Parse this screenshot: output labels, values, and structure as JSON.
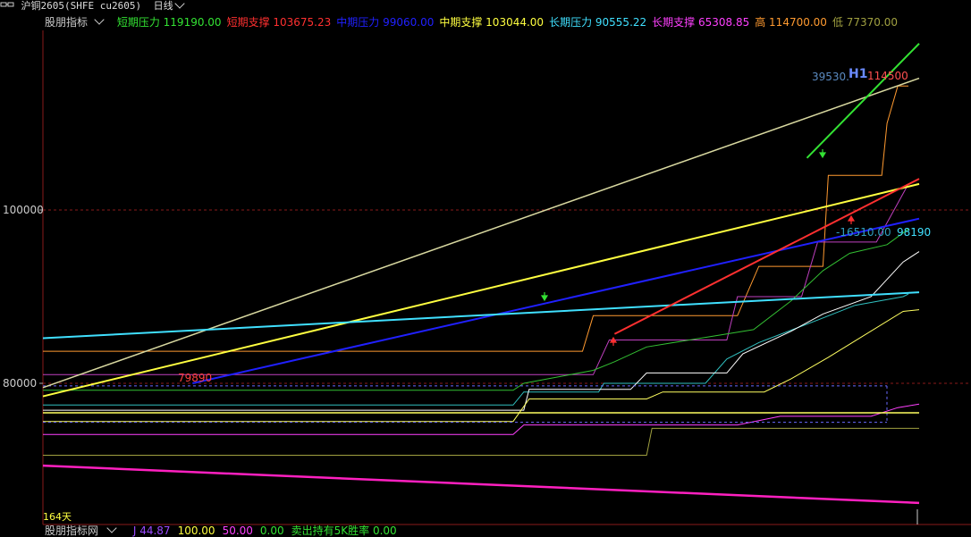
{
  "header": {
    "symbol": "沪铜2605(SHFE cu2605)",
    "period": "日线"
  },
  "legend": {
    "name": "股朋指标",
    "items": [
      {
        "label": "短期压力",
        "value": "119190.00",
        "color": "#33e233"
      },
      {
        "label": "短期支撑",
        "value": "103675.23",
        "color": "#ff3030"
      },
      {
        "label": "中期压力",
        "value": "99060.00",
        "color": "#2020ff"
      },
      {
        "label": "中期支撑",
        "value": "103044.00",
        "color": "#ffff40"
      },
      {
        "label": "长期压力",
        "value": "90555.22",
        "color": "#40e0ff"
      },
      {
        "label": "长期支撑",
        "value": "65308.85",
        "color": "#ff40ff"
      },
      {
        "label": "高",
        "value": "114700.00",
        "color": "#ff9a30"
      },
      {
        "label": "低",
        "value": "77370.00",
        "color": "#a0a040"
      }
    ]
  },
  "subwindow": {
    "name": "股朋指标网",
    "items": [
      {
        "label": "J",
        "value": "44.87",
        "color": "#9a4aff"
      },
      {
        "label": "",
        "value": "100.00",
        "color": "#ffff40"
      },
      {
        "label": "",
        "value": "50.00",
        "color": "#ff40ff"
      },
      {
        "label": "",
        "value": "0.00",
        "color": "#33e233"
      },
      {
        "label": "卖出持有5K胜率",
        "value": "0.00",
        "color": "#33e233"
      }
    ]
  },
  "chart_data": {
    "type": "line",
    "y_ticks": [
      "100000",
      "80000"
    ],
    "ylim": [
      65000,
      120000
    ],
    "annotations": {
      "low_mark": "79890",
      "mid_left": "39530.",
      "h1": "H1",
      "high_mark": "114500",
      "neg_value": "-16510.00",
      "last_value": "98190",
      "days": "164天"
    },
    "series": [
      {
        "color": "#d8d8a0",
        "points": [
          [
            0,
            79500
          ],
          [
            164,
            115200
          ]
        ]
      },
      {
        "color": "#33e233",
        "points": [
          [
            143,
            106000
          ],
          [
            164,
            119200
          ]
        ]
      },
      {
        "color": "#ffff40",
        "points": [
          [
            0,
            78500
          ],
          [
            164,
            103000
          ]
        ]
      },
      {
        "color": "#2020ff",
        "points": [
          [
            28,
            80000
          ],
          [
            164,
            99000
          ]
        ]
      },
      {
        "color": "#40e0ff",
        "points": [
          [
            0,
            85200
          ],
          [
            164,
            90500
          ]
        ]
      },
      {
        "color": "#ff3030",
        "points": [
          [
            107,
            85700
          ],
          [
            164,
            103600
          ]
        ]
      },
      {
        "color": "#ff20c0",
        "points": [
          [
            0,
            70500
          ],
          [
            164,
            66200
          ]
        ]
      }
    ]
  }
}
